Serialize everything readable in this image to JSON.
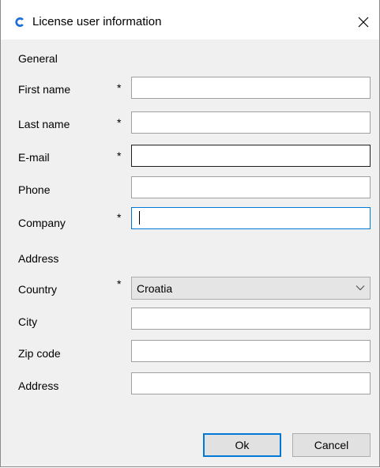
{
  "window": {
    "title": "License user information",
    "close_glyph": "✕"
  },
  "sections": {
    "general": "General",
    "address": "Address"
  },
  "required_marker": "*",
  "fields": {
    "first_name": {
      "label": "First name",
      "value": "",
      "required": true
    },
    "last_name": {
      "label": "Last name",
      "value": "",
      "required": true
    },
    "email": {
      "label": "E-mail",
      "value": "",
      "required": true
    },
    "phone": {
      "label": "Phone",
      "value": "",
      "required": false
    },
    "company": {
      "label": "Company",
      "value": "",
      "required": true
    },
    "country": {
      "label": "Country",
      "value": "Croatia",
      "required": true
    },
    "city": {
      "label": "City",
      "value": "",
      "required": false
    },
    "zip_code": {
      "label": "Zip code",
      "value": "",
      "required": false
    },
    "address": {
      "label": "Address",
      "value": "",
      "required": false
    }
  },
  "buttons": {
    "ok": "Ok",
    "cancel": "Cancel"
  },
  "colors": {
    "accent": "#0078d7",
    "app_icon": "#1e6fd9"
  },
  "icons": {
    "app": "app-logo-icon",
    "close": "close-icon",
    "dropdown": "chevron-down-icon"
  }
}
